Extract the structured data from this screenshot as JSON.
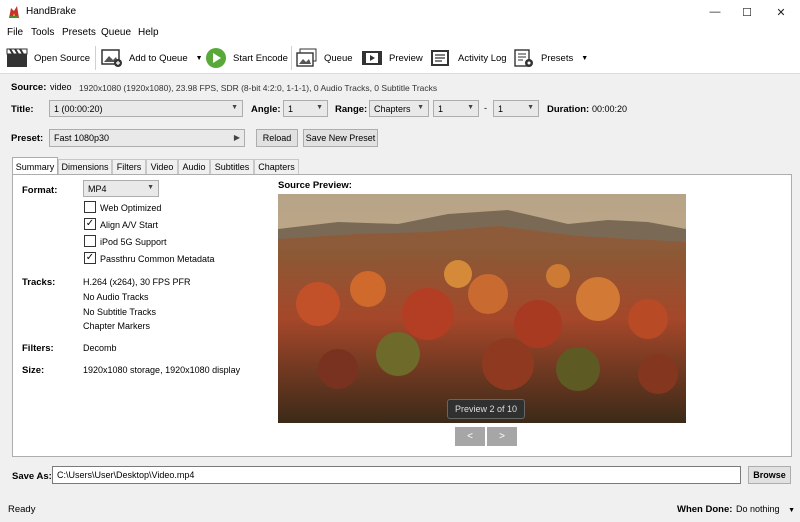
{
  "window": {
    "title": "HandBrake",
    "minimize": "—",
    "maximize": "☐",
    "close": "✕"
  },
  "menu": [
    "File",
    "Tools",
    "Presets",
    "Queue",
    "Help"
  ],
  "toolbar": {
    "open_source": "Open Source",
    "add_to_queue": "Add to Queue",
    "start_encode": "Start Encode",
    "queue": "Queue",
    "preview": "Preview",
    "activity_log": "Activity Log",
    "presets": "Presets"
  },
  "source": {
    "label": "Source:",
    "name": "video",
    "details": "1920x1080 (1920x1080), 23.98 FPS, SDR (8-bit 4:2:0, 1-1-1), 0 Audio Tracks, 0 Subtitle Tracks"
  },
  "title_row": {
    "title_label": "Title:",
    "title_value": "1 (00:00:20)",
    "angle_label": "Angle:",
    "angle_value": "1",
    "range_label": "Range:",
    "range_value": "Chapters",
    "range_start": "1",
    "range_dash": "-",
    "range_end": "1",
    "duration_label": "Duration:",
    "duration_value": "00:00:20"
  },
  "preset": {
    "label": "Preset:",
    "value": "Fast 1080p30",
    "reload": "Reload",
    "save_new": "Save New Preset"
  },
  "tabs": [
    "Summary",
    "Dimensions",
    "Filters",
    "Video",
    "Audio",
    "Subtitles",
    "Chapters"
  ],
  "summary": {
    "format_label": "Format:",
    "format_value": "MP4",
    "options": [
      {
        "label": "Web Optimized",
        "checked": false
      },
      {
        "label": "Align A/V Start",
        "checked": true
      },
      {
        "label": "iPod 5G Support",
        "checked": false
      },
      {
        "label": "Passthru Common Metadata",
        "checked": true
      }
    ],
    "tracks_label": "Tracks:",
    "tracks": [
      "H.264 (x264), 30 FPS PFR",
      "No Audio Tracks",
      "No Subtitle Tracks",
      "Chapter Markers"
    ],
    "filters_label": "Filters:",
    "filters_value": "Decomb",
    "size_label": "Size:",
    "size_value": "1920x1080 storage, 1920x1080 display"
  },
  "preview": {
    "label": "Source Preview:",
    "badge": "Preview 2 of 10",
    "prev": "<",
    "next": ">"
  },
  "save": {
    "label": "Save As:",
    "path": "C:\\Users\\User\\Desktop\\Video.mp4",
    "browse": "Browse"
  },
  "status": {
    "text": "Ready",
    "when_done_label": "When Done:",
    "when_done_value": "Do nothing"
  }
}
